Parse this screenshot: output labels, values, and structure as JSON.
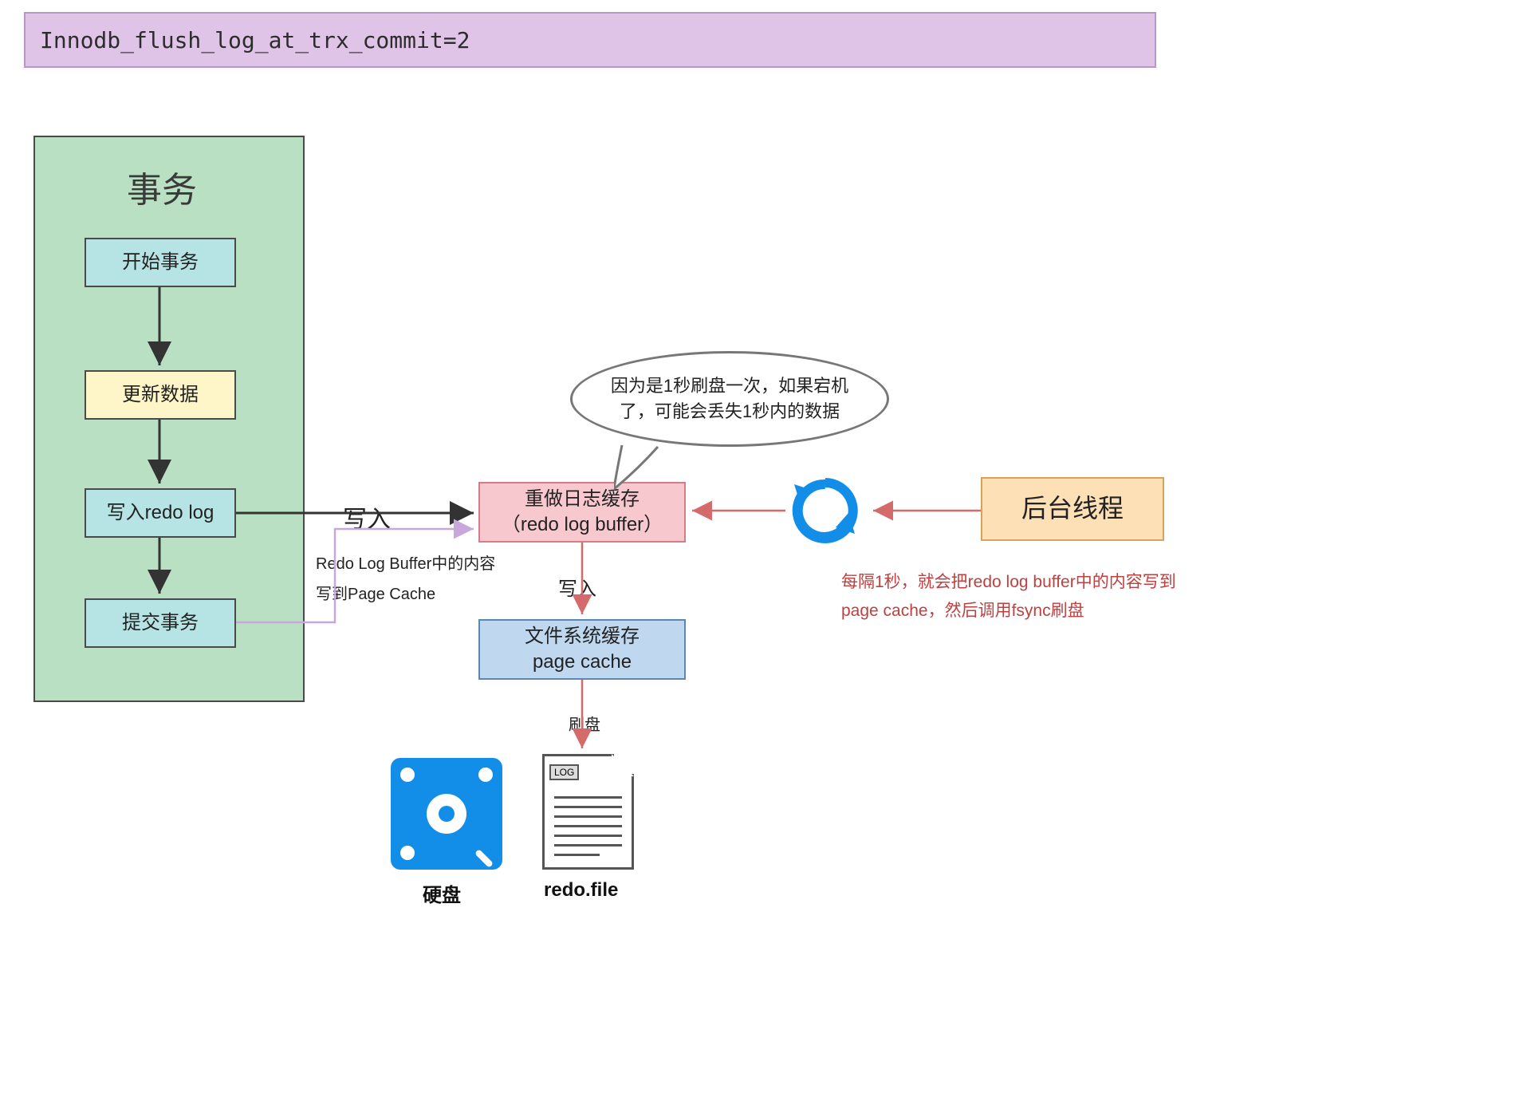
{
  "title": "Innodb_flush_log_at_trx_commit=2",
  "tx": {
    "heading": "事务",
    "start": "开始事务",
    "update": "更新数据",
    "write_redo": "写入redo log",
    "commit": "提交事务"
  },
  "arrows": {
    "write": "写入",
    "write2": "写入",
    "commit_note_l1": "Redo Log Buffer中的内容",
    "commit_note_l2": "写到Page Cache",
    "flush": "刷盘"
  },
  "buffer": {
    "l1": "重做日志缓存",
    "l2": "（redo log buffer）"
  },
  "pagecache": {
    "l1": "文件系统缓存",
    "l2": "page cache"
  },
  "bg_thread": "后台线程",
  "speech": "因为是1秒刷盘一次，如果宕机了，可能会丢失1秒内的数据",
  "bg_note": "每隔1秒，就会把redo log buffer中的内容写到page cache，然后调用fsync刷盘",
  "disk_label": "硬盘",
  "file_label": "redo.file",
  "file_tag": "LOG"
}
